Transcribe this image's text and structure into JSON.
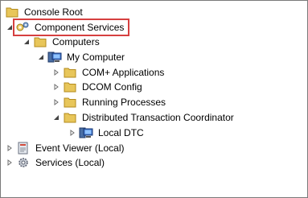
{
  "tree": {
    "console_root": "Console Root",
    "component_services": "Component Services",
    "computers": "Computers",
    "my_computer": "My Computer",
    "com_applications": "COM+ Applications",
    "dcom_config": "DCOM Config",
    "running_processes": "Running Processes",
    "dtc": "Distributed Transaction Coordinator",
    "local_dtc": "Local DTC",
    "event_viewer": "Event Viewer (Local)",
    "services": "Services (Local)"
  },
  "colors": {
    "selection_border": "#d64040",
    "folder": "#e8c65a",
    "expander": "#6e6e6e"
  },
  "icons": {
    "console_root": "folder-icon",
    "component_services": "gear-cog-icon",
    "computers": "folder-icon",
    "my_computer": "computer-monitor-icon",
    "com_applications": "folder-icon",
    "dcom_config": "folder-icon",
    "running_processes": "folder-icon",
    "dtc": "folder-icon",
    "local_dtc": "dtc-monitor-icon",
    "event_viewer": "event-log-icon",
    "services": "services-gear-icon"
  }
}
